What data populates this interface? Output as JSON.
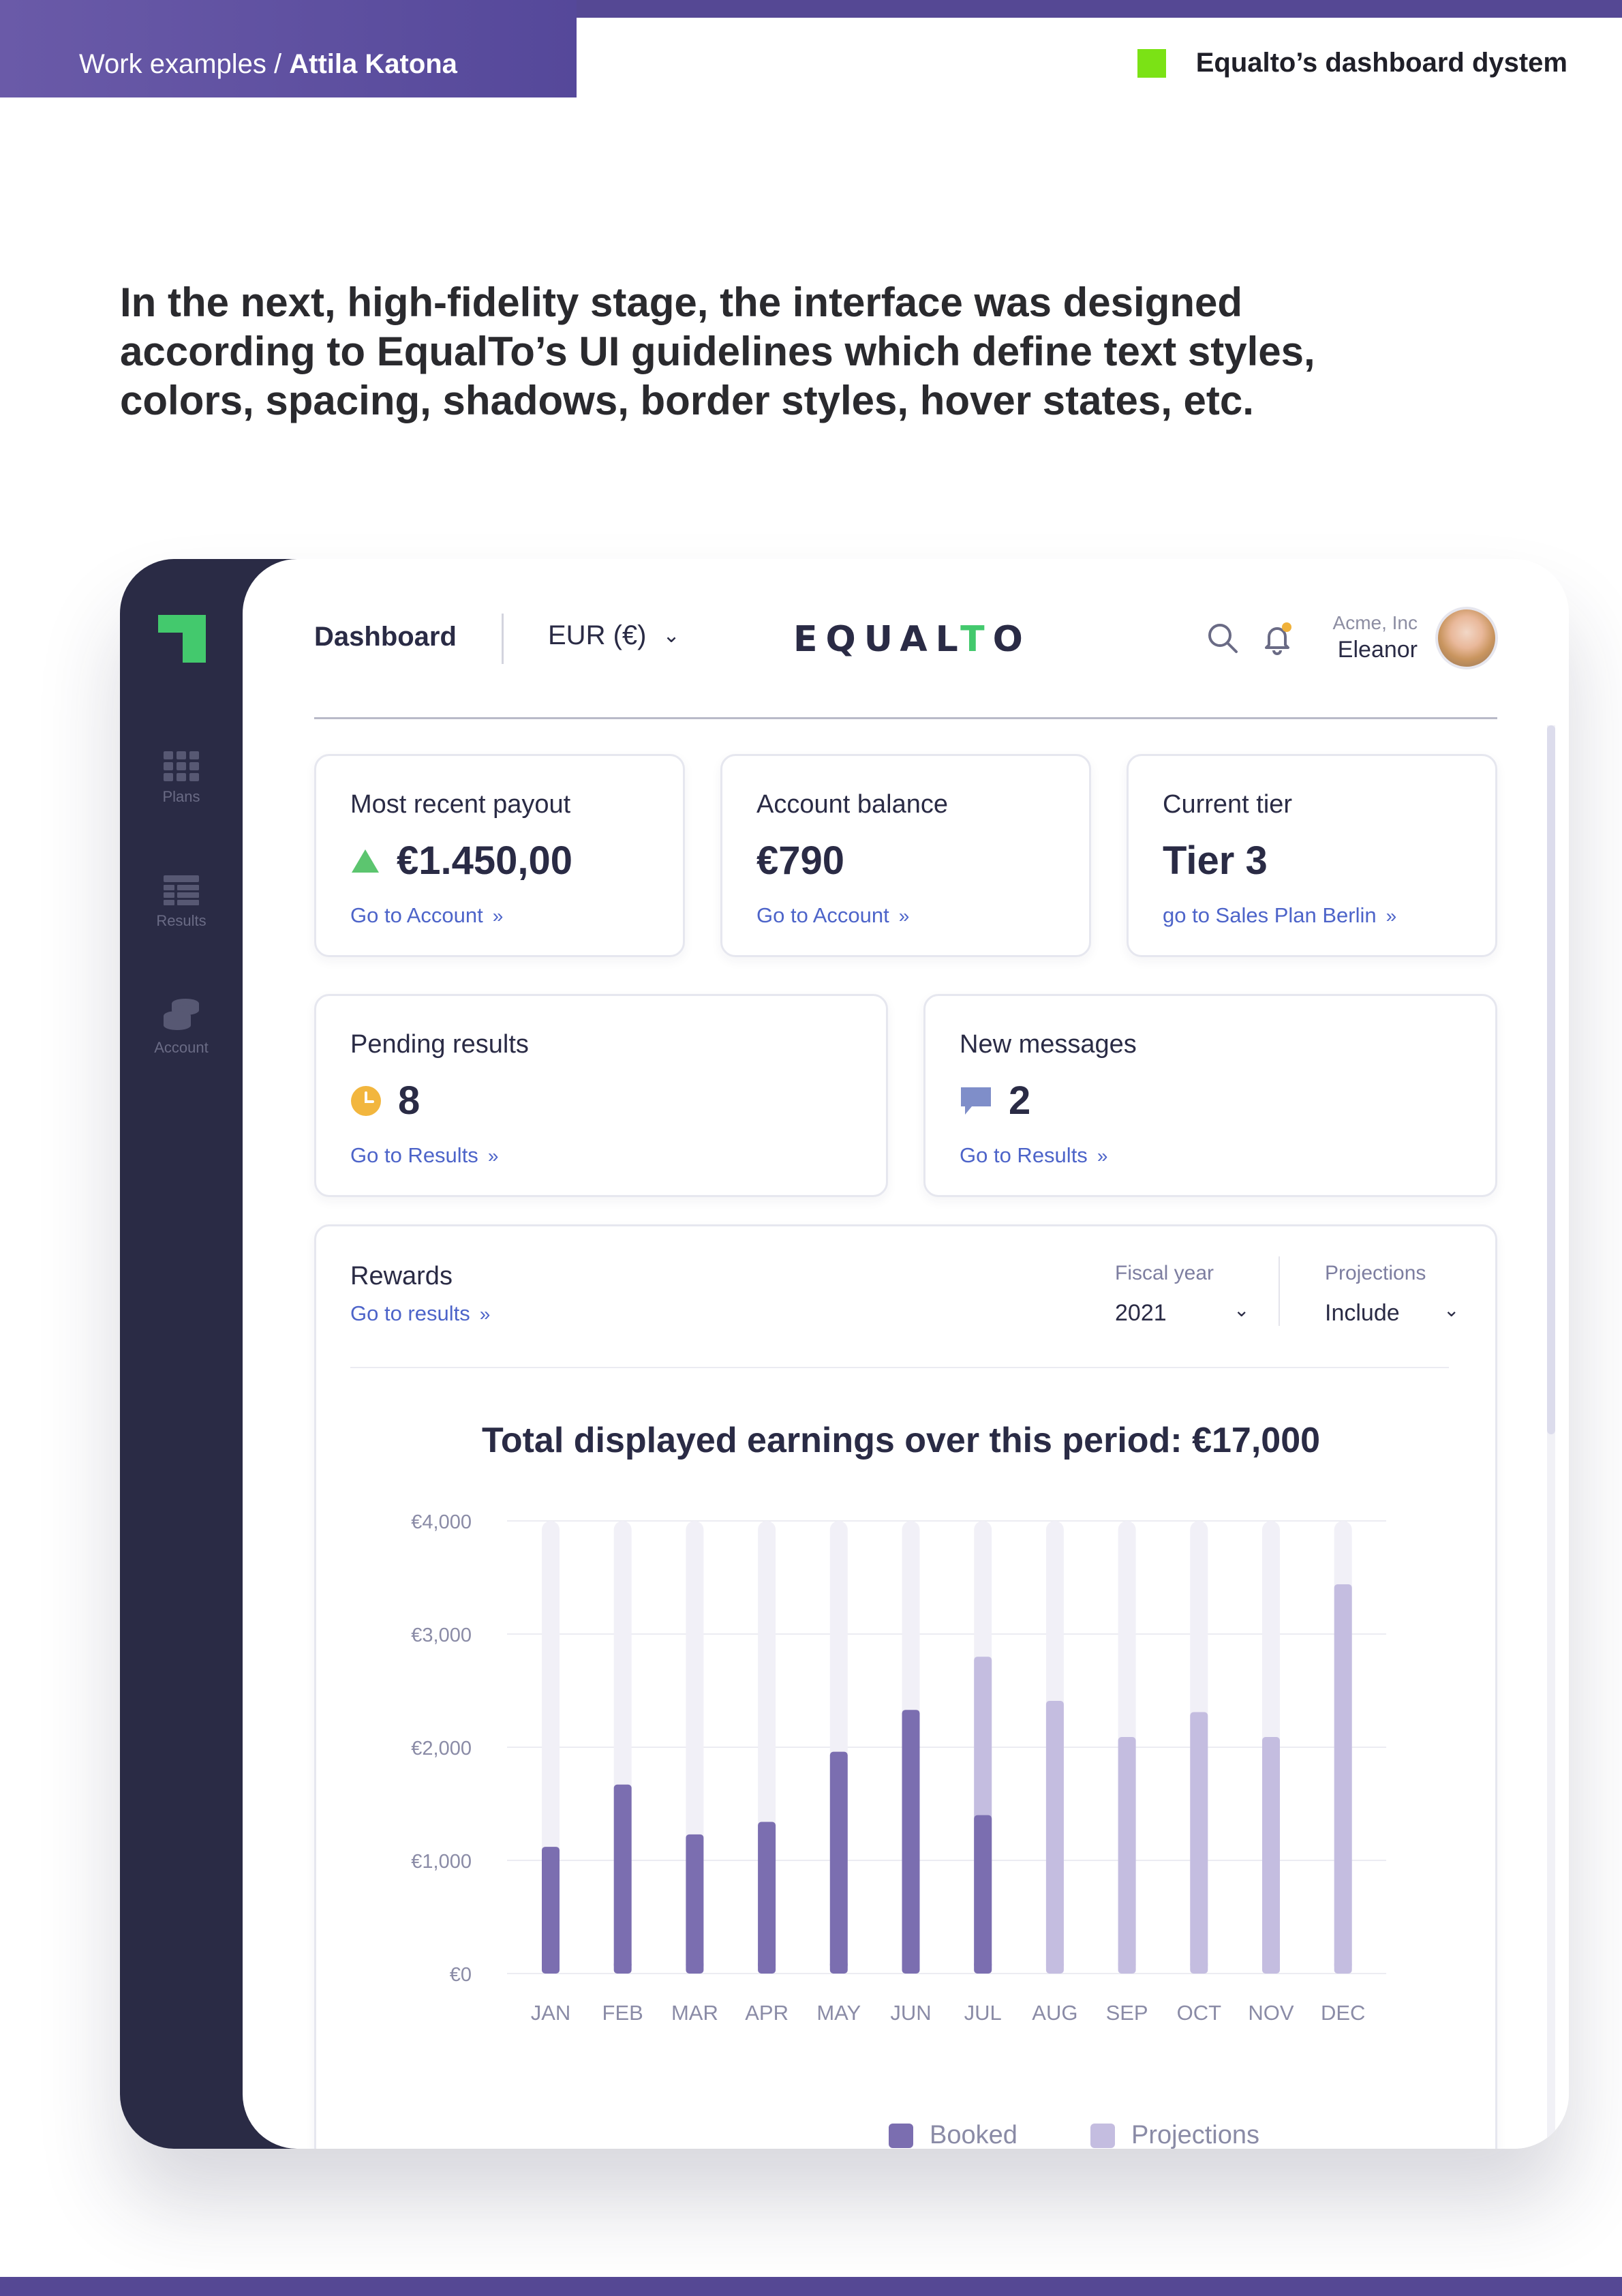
{
  "page": {
    "breadcrumb_prefix": "Work examples / ",
    "breadcrumb_name": "Attila Katona",
    "project_title": "Equalto’s dashboard dystem",
    "intro": "In the next, high-fidelity stage, the interface was designed according to EqualTo’s UI guidelines which define text styles, colors, spacing, shadows, border styles, hover states, etc."
  },
  "sidebar": {
    "items": [
      {
        "label": "Plans",
        "icon": "grid-icon"
      },
      {
        "label": "Results",
        "icon": "table-icon"
      },
      {
        "label": "Account",
        "icon": "coins-icon"
      }
    ]
  },
  "header": {
    "title": "Dashboard",
    "currency": "EUR (€)",
    "logo_left": "EQUAL",
    "logo_t": "T",
    "logo_right": "O",
    "org": "Acme, Inc",
    "user": "Eleanor"
  },
  "cards": [
    {
      "label": "Most recent payout",
      "value": "€1.450,00",
      "link": "Go to Account",
      "indicator": "up-triangle-icon"
    },
    {
      "label": "Account balance",
      "value": "€790",
      "link": "Go to Account"
    },
    {
      "label": "Current tier",
      "value": "Tier 3",
      "link": "go to Sales Plan Berlin"
    },
    {
      "label": "Pending results",
      "value": "8",
      "link": "Go to Results",
      "indicator": "clock-icon"
    },
    {
      "label": "New messages",
      "value": "2",
      "link": "Go to Results",
      "indicator": "message-icon"
    }
  ],
  "rewards": {
    "title": "Rewards",
    "link": "Go to results",
    "fiscal_label": "Fiscal year",
    "fiscal_value": "2021",
    "projections_label": "Projections",
    "projections_value": "Include"
  },
  "colors": {
    "brand_purple": "#554894",
    "booked": "#7b6eb0",
    "projection": "#c4bde0",
    "track": "#f1f0f7",
    "accent_green": "#43c96d",
    "link_blue": "#4d64c9"
  },
  "chart_data": {
    "type": "bar",
    "title": "Total displayed earnings over this period: €17,000",
    "categories": [
      "JAN",
      "FEB",
      "MAR",
      "APR",
      "MAY",
      "JUN",
      "JUL",
      "AUG",
      "SEP",
      "OCT",
      "NOV",
      "DEC"
    ],
    "series": [
      {
        "name": "Booked",
        "values": [
          1120,
          1670,
          1230,
          1340,
          1960,
          2330,
          1400,
          0,
          0,
          0,
          0,
          0
        ]
      },
      {
        "name": "Projections",
        "values": [
          0,
          0,
          0,
          0,
          0,
          0,
          1400,
          2410,
          2090,
          2310,
          2090,
          3440
        ]
      }
    ],
    "ylim": [
      0,
      4000
    ],
    "yticks": [
      "€0",
      "€1,000",
      "€2,000",
      "€3,000",
      "€4,000"
    ],
    "grid": true,
    "legend": "bottom-center"
  }
}
